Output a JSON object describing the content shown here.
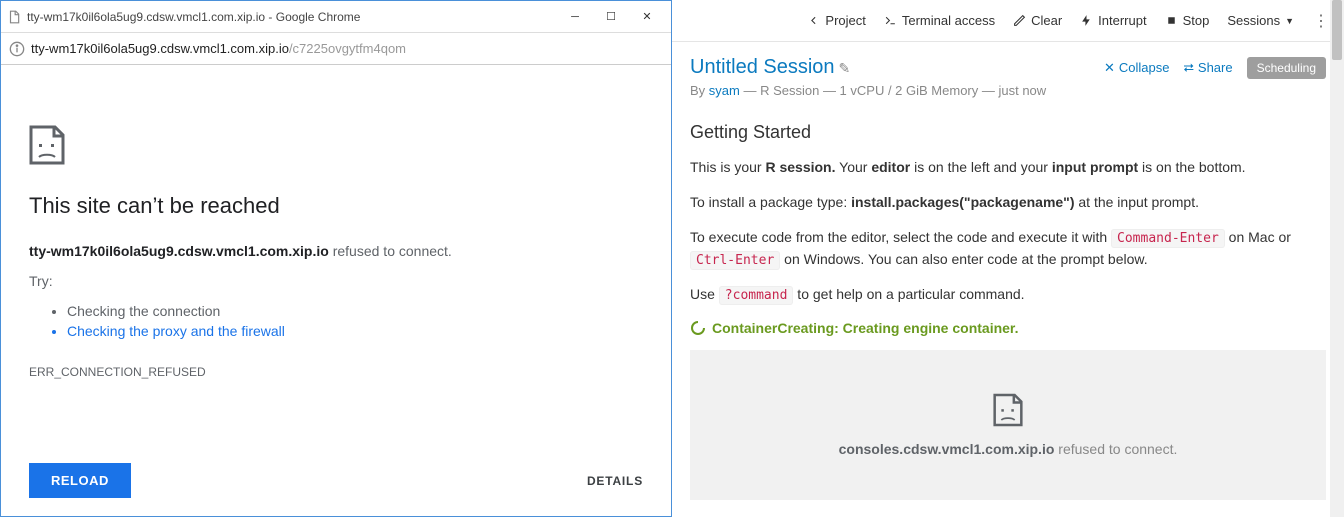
{
  "chrome": {
    "title": "tty-wm17k0il6ola5ug9.cdsw.vmcl1.com.xip.io - Google Chrome",
    "url_host": "tty-wm17k0il6ola5ug9.cdsw.vmcl1.com.xip.io",
    "url_path": "/c7225ovgytfm4qom"
  },
  "error": {
    "heading": "This site can’t be reached",
    "host_bold": "tty-wm17k0il6ola5ug9.cdsw.vmcl1.com.xip.io",
    "host_msg": " refused to connect.",
    "try_label": "Try:",
    "tip1": "Checking the connection",
    "tip2": "Checking the proxy and the firewall",
    "code": "ERR_CONNECTION_REFUSED",
    "reload": "RELOAD",
    "details": "DETAILS"
  },
  "toolbar": {
    "project": "Project",
    "terminal": "Terminal access",
    "clear": "Clear",
    "interrupt": "Interrupt",
    "stop": "Stop",
    "sessions": "Sessions"
  },
  "session": {
    "title": "Untitled Session",
    "by_prefix": "By ",
    "user": "syam",
    "meta": " — R Session — 1 vCPU / 2 GiB Memory — just now",
    "collapse": "Collapse",
    "share": "Share",
    "scheduling": "Scheduling"
  },
  "getting_started": {
    "heading": "Getting Started",
    "p1a": "This is your ",
    "p1b": "R session.",
    "p1c": " Your ",
    "p1d": "editor",
    "p1e": " is on the left and your ",
    "p1f": "input prompt",
    "p1g": " is on the bottom.",
    "p2a": "To install a package type: ",
    "p2b": "install.packages(\"packagename\")",
    "p2c": " at the input prompt.",
    "p3a": "To execute code from the editor, select the code and execute it with ",
    "p3b": "Command-Enter",
    "p3c": " on Mac or ",
    "p3d": "Ctrl-Enter",
    "p3e": " on Windows. You can also enter code at the prompt below.",
    "p4a": "Use ",
    "p4b": "?command",
    "p4c": " to get help on a particular command."
  },
  "status": {
    "text": "ContainerCreating: Creating engine container."
  },
  "console_err": {
    "host": "consoles.cdsw.vmcl1.com.xip.io",
    "msg": " refused to connect."
  }
}
